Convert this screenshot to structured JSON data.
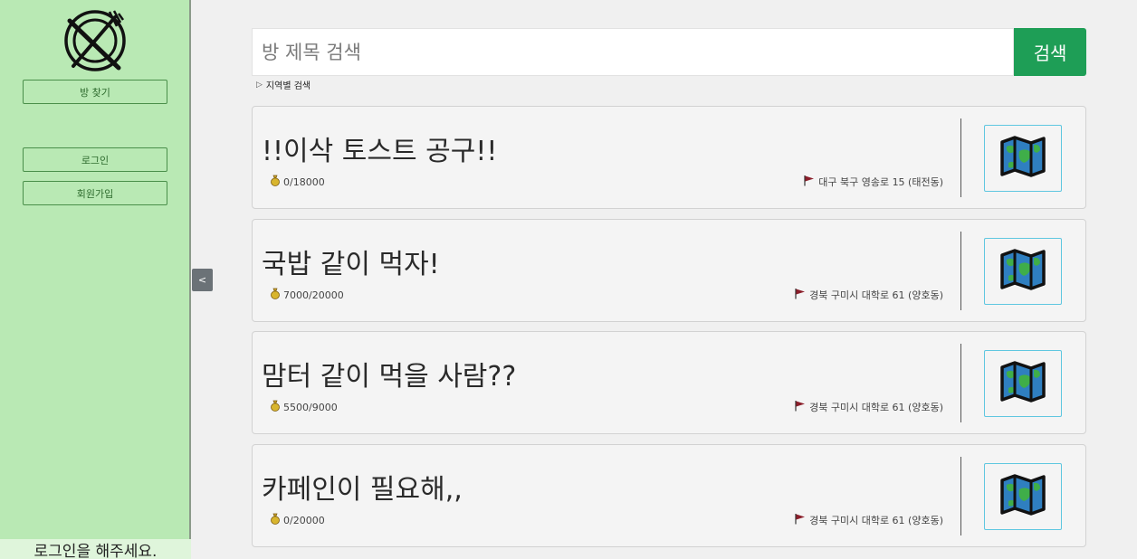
{
  "sidebar": {
    "find_room": "방 찾기",
    "login": "로그인",
    "signup": "회원가입",
    "login_prompt": "로그인을 해주세요.",
    "collapse": "<"
  },
  "search": {
    "placeholder": "방 제목 검색",
    "button": "검색",
    "region_toggle": "지역별 검색"
  },
  "rooms": [
    {
      "title": "!!이삭 토스트 공구!!",
      "price": "0/18000",
      "location": "대구 북구 영송로 15 (태전동)"
    },
    {
      "title": "국밥 같이 먹자!",
      "price": "7000/20000",
      "location": "경북 구미시 대학로 61 (양호동)"
    },
    {
      "title": "맘터 같이 먹을 사람??",
      "price": "5500/9000",
      "location": "경북 구미시 대학로 61 (양호동)"
    },
    {
      "title": "카페인이 필요해,,",
      "price": "0/20000",
      "location": "경북 구미시 대학로 61 (양호동)"
    }
  ],
  "icons": {
    "logo": "plate-fork-knife-icon",
    "price": "money-bag-icon",
    "location": "red-flag-icon",
    "map": "map-icon"
  },
  "colors": {
    "sidebar_bg": "#b9e9b4",
    "search_button": "#1e9e56",
    "map_border": "#5fc7e0",
    "flag": "#8b1e2a"
  }
}
